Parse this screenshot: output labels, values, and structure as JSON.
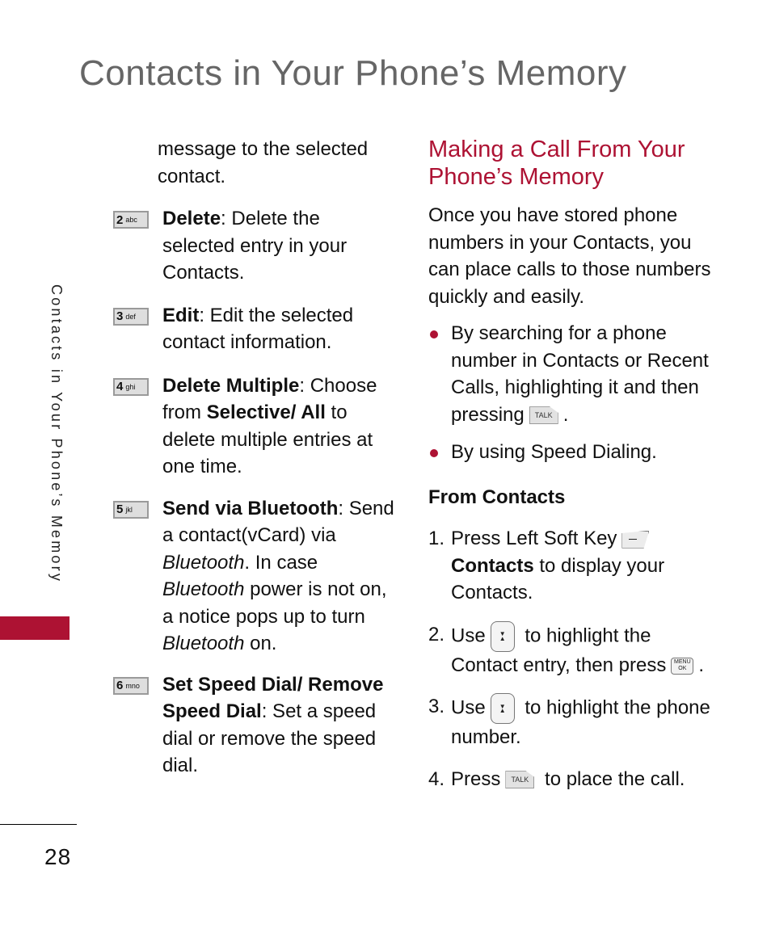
{
  "page": {
    "title": "Contacts in Your Phone’s Memory",
    "side_tab": "Contacts in Your Phone’s Memory",
    "page_number": "28",
    "accent_color": "#ad1233"
  },
  "left": {
    "intro": "message to the selected contact.",
    "options": [
      {
        "key_num": "2",
        "key_letters": "abc",
        "term": "Delete",
        "desc": ": Delete the selected entry in your Contacts."
      },
      {
        "key_num": "3",
        "key_letters": "def",
        "term": "Edit",
        "desc": ": Edit the selected contact information."
      },
      {
        "key_num": "4",
        "key_letters": "ghi",
        "term": "Delete Multiple",
        "desc": ": Choose from ",
        "term2": "Selective/ All",
        "desc2": " to delete multiple entries at one time."
      },
      {
        "key_num": "5",
        "key_letters": "jkl",
        "term": "Send via Bluetooth",
        "desc": ": Send a contact(vCard) via ",
        "em1": "Bluetooth",
        "desc2": ". In case ",
        "em2": "Bluetooth",
        "desc3": " power is not on, a notice pops up to turn ",
        "em3": "Bluetooth",
        "desc4": " on."
      },
      {
        "key_num": "6",
        "key_letters": "mno",
        "term": "Set Speed Dial/ Remove Speed Dial",
        "desc": ": Set a speed dial or remove the speed dial."
      }
    ]
  },
  "right": {
    "section_title": "Making a Call From Your Phone’s Memory",
    "intro": "Once you have stored phone numbers in your Contacts, you can place calls to those numbers quickly and easily.",
    "bullets": [
      {
        "text": "By searching for a phone number in Contacts or Recent Calls, highlighting it and then pressing",
        "suffix": "."
      },
      {
        "text": "By using Speed Dialing."
      }
    ],
    "subhead": "From Contacts",
    "steps": [
      {
        "num": "1.",
        "pre": "Press Left Soft Key",
        "bold": "Contacts",
        "post": " to display your Contacts."
      },
      {
        "num": "2.",
        "pre": "Use",
        "mid": " to highlight the Contact entry, then press",
        "post": "."
      },
      {
        "num": "3.",
        "pre": "Use",
        "mid": " to highlight the phone number."
      },
      {
        "num": "4.",
        "pre": "Press",
        "mid": " to place the call."
      }
    ],
    "icons": {
      "talk_label": "TALK",
      "menu_label": "MENU",
      "ok_label": "OK",
      "up_arrow": "▲",
      "down_arrow": "▼"
    }
  }
}
